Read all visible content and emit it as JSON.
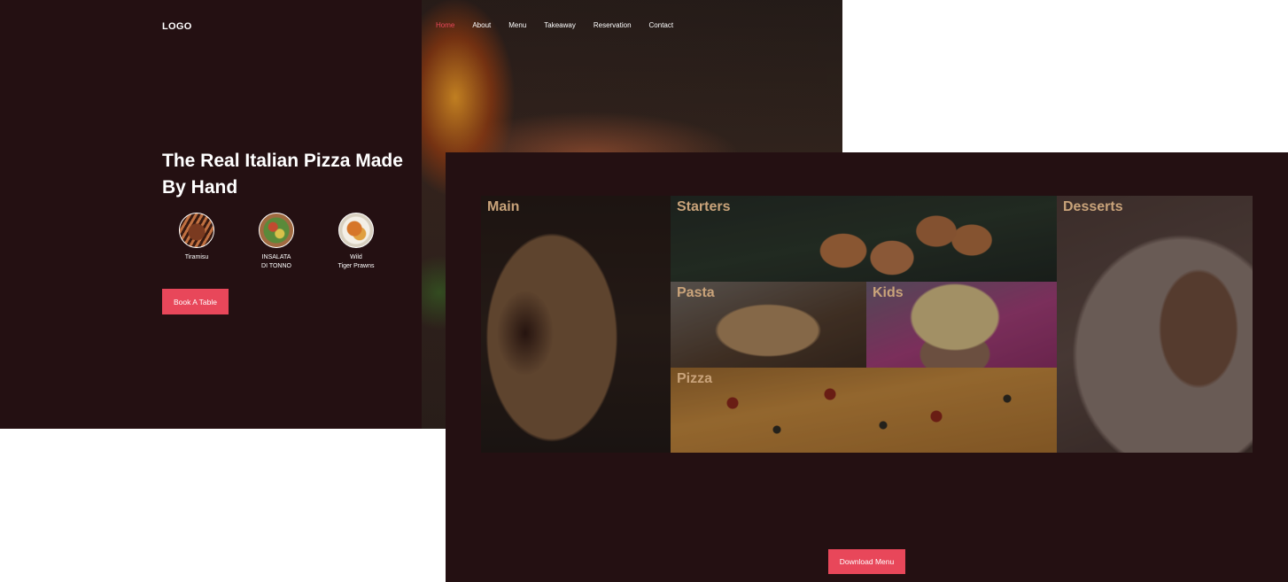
{
  "hero": {
    "logo": "LOGO",
    "nav": {
      "home": "Home",
      "about": "About",
      "menu": "Menu",
      "takeaway": "Takeaway",
      "reservation": "Reservation",
      "contact": "Contact"
    },
    "headline": "The Real Italian Pizza Made By Hand",
    "dishes": [
      {
        "name": "Tiramisu"
      },
      {
        "name": "INSALATA\nDI TONNO"
      },
      {
        "name": "Wild\nTiger Prawns"
      }
    ],
    "book_button": "Book A Table"
  },
  "menu_screen": {
    "categories": {
      "main": "Main",
      "starters": "Starters",
      "desserts": "Desserts",
      "pasta": "Pasta",
      "kids": "Kids",
      "pizza": "Pizza"
    },
    "download_button": "Download Menu"
  },
  "colors": {
    "background_dark": "#241012",
    "accent_red": "#e8475a",
    "category_label": "#c9a37a"
  }
}
